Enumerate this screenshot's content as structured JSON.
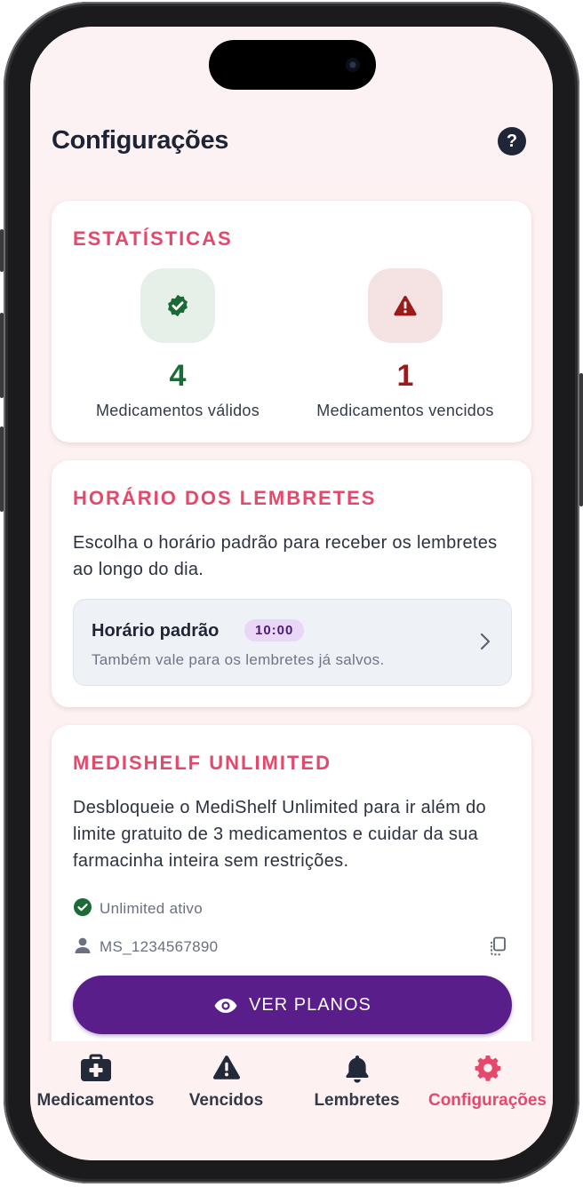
{
  "header": {
    "title": "Configurações",
    "help_label": "?"
  },
  "stats": {
    "title": "ESTATÍSTICAS",
    "valid": {
      "value": "4",
      "label": "Medicamentos válidos",
      "color": "#1b6b37"
    },
    "expired": {
      "value": "1",
      "label": "Medicamentos vencidos",
      "color": "#9b1b1b"
    }
  },
  "reminders": {
    "title": "HORÁRIO DOS LEMBRETES",
    "description": "Escolha o horário padrão para receber os lembretes ao longo do dia.",
    "default_label": "Horário padrão",
    "time": "10:00",
    "note": "Também vale para os lembretes já salvos."
  },
  "unlimited": {
    "title": "MEDISHELF UNLIMITED",
    "description": "Desbloqueie o MediShelf Unlimited para ir além do limite gratuito de 3 medicamentos e cuidar da sua farmacinha inteira sem restrições.",
    "status": "Unlimited ativo",
    "user_id": "MS_1234567890",
    "button": "VER PLANOS"
  },
  "tabs": [
    {
      "label": "Medicamentos",
      "icon": "medkit-icon",
      "active": false
    },
    {
      "label": "Vencidos",
      "icon": "warning-icon",
      "active": false
    },
    {
      "label": "Lembretes",
      "icon": "bell-icon",
      "active": false
    },
    {
      "label": "Configurações",
      "icon": "gear-icon",
      "active": true
    }
  ],
  "colors": {
    "accent": "#e5486a",
    "primary": "#5a1e8a",
    "valid": "#1b6b37",
    "expired": "#9b1b1b"
  }
}
